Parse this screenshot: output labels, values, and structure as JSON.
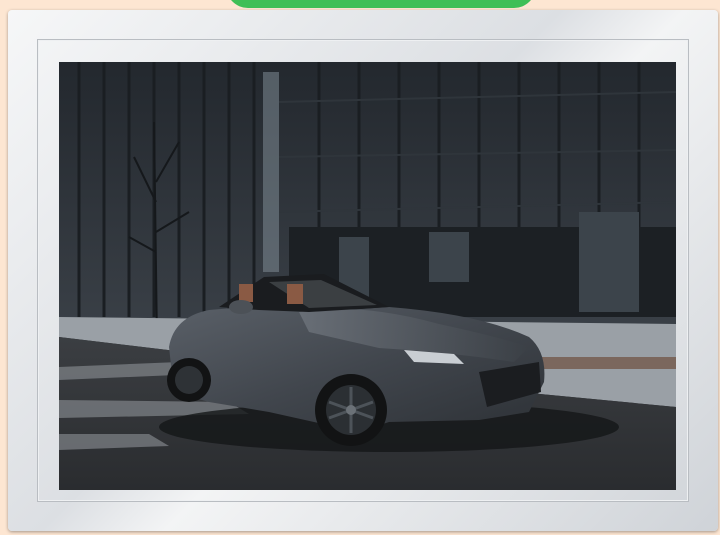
{
  "frame": {
    "style": "silver-bevel"
  },
  "photo": {
    "subject": "car-photo"
  },
  "colors": {
    "background": "#fde6d2",
    "accent_tab": "#3fbf56",
    "frame": "#dcdfe3",
    "car": "#4a4f56"
  }
}
